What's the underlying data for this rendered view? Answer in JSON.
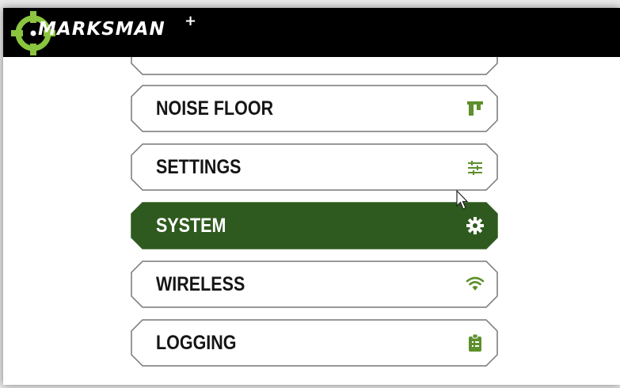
{
  "brand": {
    "name": "MARKSMAN",
    "suffix": "+"
  },
  "colors": {
    "accent": "#2f5a1f",
    "icon_green": "#5d8f2c",
    "logo_green": "#8bc53f",
    "header_bg": "#000000",
    "outline": "#777777"
  },
  "menu": {
    "items": [
      {
        "label": "NOISE FLOOR",
        "icon": "bar-chart-icon",
        "active": false
      },
      {
        "label": "SETTINGS",
        "icon": "sliders-icon",
        "active": false
      },
      {
        "label": "SYSTEM",
        "icon": "gear-icon",
        "active": true
      },
      {
        "label": "WIRELESS",
        "icon": "wifi-icon",
        "active": false
      },
      {
        "label": "LOGGING",
        "icon": "clipboard-icon",
        "active": false
      }
    ]
  }
}
